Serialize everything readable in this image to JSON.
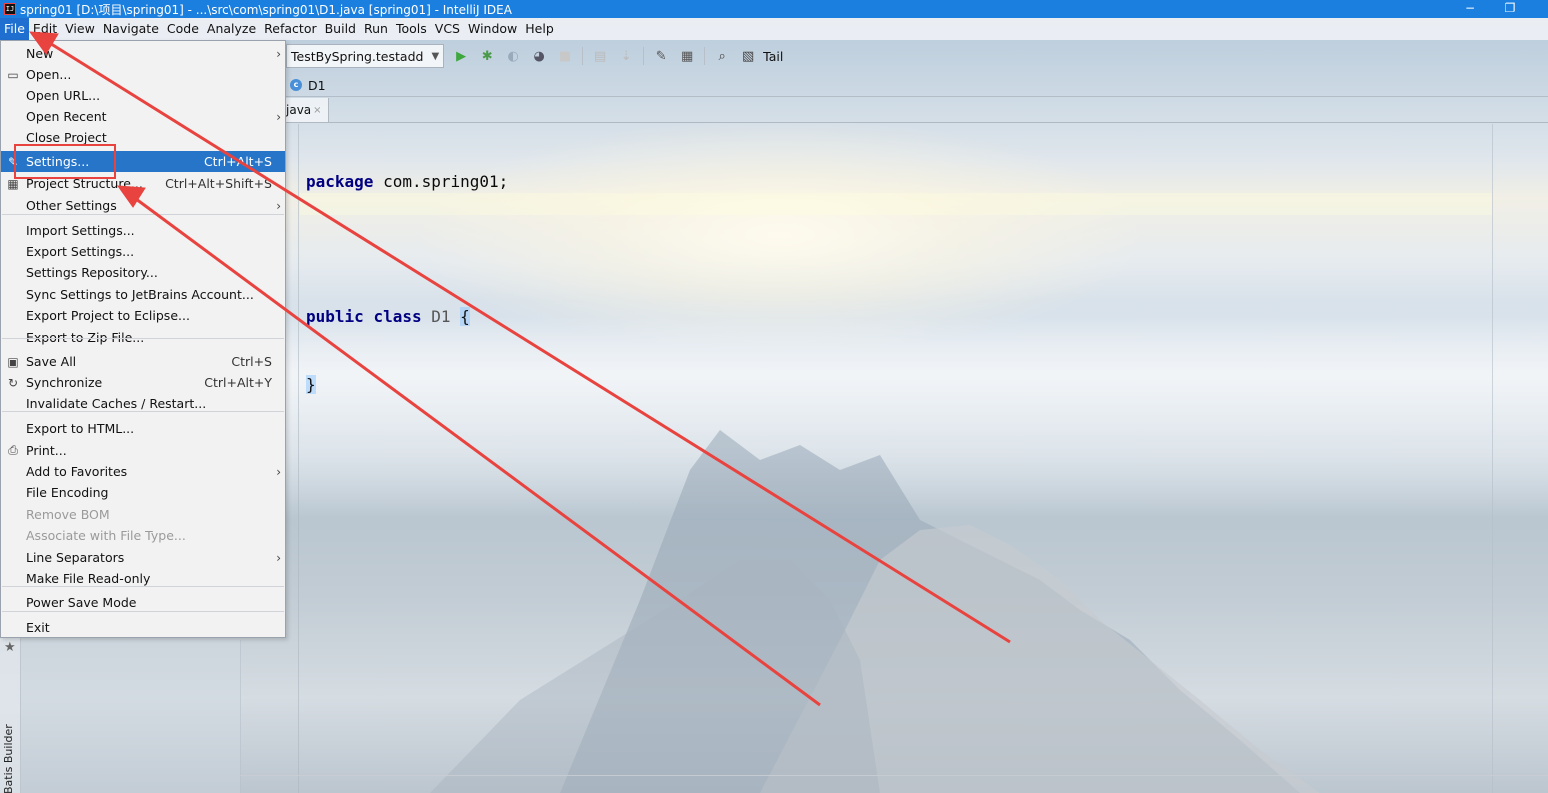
{
  "window": {
    "title": "spring01 [D:\\项目\\spring01] - ...\\src\\com\\spring01\\D1.java [spring01] - IntelliJ IDEA",
    "minimize_glyph": "−",
    "restore_glyph": "❐"
  },
  "menubar": {
    "items": [
      "File",
      "Edit",
      "View",
      "Navigate",
      "Code",
      "Analyze",
      "Refactor",
      "Build",
      "Run",
      "Tools",
      "VCS",
      "Window",
      "Help"
    ]
  },
  "toolbar": {
    "run_config": "TestBySpring.testadd",
    "tail_label": "Tail"
  },
  "navbar": {
    "class_badge": "c",
    "crumb": "D1"
  },
  "tabs": {
    "active_tab": "java",
    "close_glyph": "×"
  },
  "editor": {
    "line1_kw": "package",
    "line1_rest": " com.spring01;",
    "line3_kw1": "public",
    "line3_kw2": "class",
    "line3_name": "D1",
    "line3_brace": "{",
    "line4_brace": "}"
  },
  "left_strip": {
    "label": "MyBatis Builder"
  },
  "file_menu": {
    "items": [
      {
        "label": "New",
        "shortcut": "",
        "submenu": true,
        "icon": "",
        "disabled": false,
        "selected": false
      },
      {
        "label": "Open...",
        "shortcut": "",
        "submenu": false,
        "icon": "folder-open-icon",
        "disabled": false,
        "selected": false
      },
      {
        "label": "Open URL...",
        "shortcut": "",
        "submenu": false,
        "icon": "",
        "disabled": false,
        "selected": false
      },
      {
        "label": "Open Recent",
        "shortcut": "",
        "submenu": true,
        "icon": "",
        "disabled": false,
        "selected": false
      },
      {
        "label": "Close Project",
        "shortcut": "",
        "submenu": false,
        "icon": "",
        "disabled": false,
        "selected": false
      },
      {
        "label": "Settings...",
        "shortcut": "Ctrl+Alt+S",
        "submenu": false,
        "icon": "wrench-icon",
        "disabled": false,
        "selected": true
      },
      {
        "label": "Project Structure...",
        "shortcut": "Ctrl+Alt+Shift+S",
        "submenu": false,
        "icon": "project-structure-icon",
        "disabled": false,
        "selected": false
      },
      {
        "label": "Other Settings",
        "shortcut": "",
        "submenu": true,
        "icon": "",
        "disabled": false,
        "selected": false
      },
      {
        "label": "Import Settings...",
        "shortcut": "",
        "submenu": false,
        "icon": "",
        "disabled": false,
        "selected": false
      },
      {
        "label": "Export Settings...",
        "shortcut": "",
        "submenu": false,
        "icon": "",
        "disabled": false,
        "selected": false
      },
      {
        "label": "Settings Repository...",
        "shortcut": "",
        "submenu": false,
        "icon": "",
        "disabled": false,
        "selected": false
      },
      {
        "label": "Sync Settings to JetBrains Account...",
        "shortcut": "",
        "submenu": false,
        "icon": "",
        "disabled": false,
        "selected": false
      },
      {
        "label": "Export Project to Eclipse...",
        "shortcut": "",
        "submenu": false,
        "icon": "",
        "disabled": false,
        "selected": false
      },
      {
        "label": "Export to Zip File...",
        "shortcut": "",
        "submenu": false,
        "icon": "",
        "disabled": false,
        "selected": false
      },
      {
        "label": "Save All",
        "shortcut": "Ctrl+S",
        "submenu": false,
        "icon": "save-icon",
        "disabled": false,
        "selected": false
      },
      {
        "label": "Synchronize",
        "shortcut": "Ctrl+Alt+Y",
        "submenu": false,
        "icon": "sync-icon",
        "disabled": false,
        "selected": false
      },
      {
        "label": "Invalidate Caches / Restart...",
        "shortcut": "",
        "submenu": false,
        "icon": "",
        "disabled": false,
        "selected": false
      },
      {
        "label": "Export to HTML...",
        "shortcut": "",
        "submenu": false,
        "icon": "",
        "disabled": false,
        "selected": false
      },
      {
        "label": "Print...",
        "shortcut": "",
        "submenu": false,
        "icon": "printer-icon",
        "disabled": false,
        "selected": false
      },
      {
        "label": "Add to Favorites",
        "shortcut": "",
        "submenu": true,
        "icon": "",
        "disabled": false,
        "selected": false
      },
      {
        "label": "File Encoding",
        "shortcut": "",
        "submenu": false,
        "icon": "",
        "disabled": false,
        "selected": false
      },
      {
        "label": "Remove BOM",
        "shortcut": "",
        "submenu": false,
        "icon": "",
        "disabled": true,
        "selected": false
      },
      {
        "label": "Associate with File Type...",
        "shortcut": "",
        "submenu": false,
        "icon": "",
        "disabled": true,
        "selected": false
      },
      {
        "label": "Line Separators",
        "shortcut": "",
        "submenu": true,
        "icon": "",
        "disabled": false,
        "selected": false
      },
      {
        "label": "Make File Read-only",
        "shortcut": "",
        "submenu": false,
        "icon": "",
        "disabled": false,
        "selected": false
      },
      {
        "label": "Power Save Mode",
        "shortcut": "",
        "submenu": false,
        "icon": "",
        "disabled": false,
        "selected": false
      },
      {
        "label": "Exit",
        "shortcut": "",
        "submenu": false,
        "icon": "",
        "disabled": false,
        "selected": false
      }
    ],
    "submenu_glyph": "›"
  },
  "colors": {
    "titlebar": "#1a7fdf",
    "menu_selected": "#2675c9",
    "annotation_red": "#e8433f",
    "keyword": "#000080"
  }
}
